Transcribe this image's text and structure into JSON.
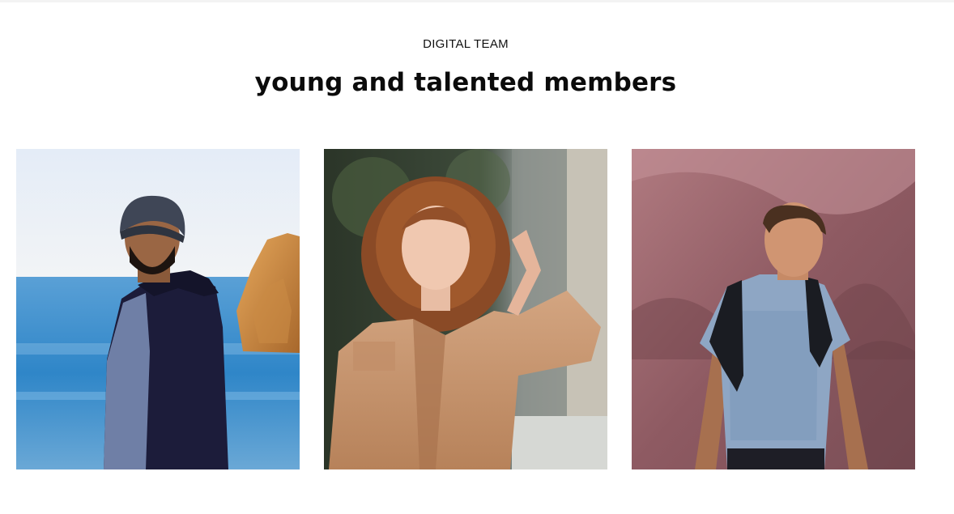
{
  "section": {
    "eyebrow": "DIGITAL TEAM",
    "heading": "young and talented members"
  },
  "members": [
    {
      "photo": "man-in-beanie-at-sea-photo"
    },
    {
      "photo": "curly-haired-woman-photo"
    },
    {
      "photo": "man-with-backpack-on-rocks-photo"
    }
  ]
}
